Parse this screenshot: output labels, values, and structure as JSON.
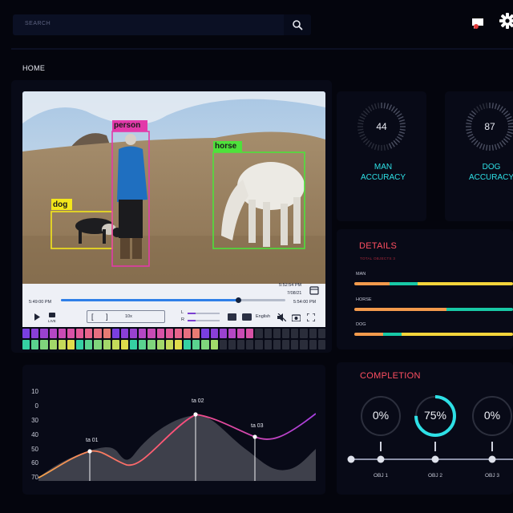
{
  "search": {
    "placeholder": "SEARCH"
  },
  "breadcrumb": "HOME",
  "detections": {
    "person": "person",
    "horse": "horse",
    "dog": "dog"
  },
  "player": {
    "start_time": "5:49:00 PM",
    "current_time": "5:52:54 PM",
    "date": "7/08/21",
    "end_time": "5:54:00 PM",
    "live_label": "LIVE",
    "bracket_open": "[",
    "bracket_close": "]",
    "speed": "10x",
    "channel_l": "L",
    "channel_r": "R",
    "cc_label": "CC",
    "language": "English",
    "progress": 0.79
  },
  "gauges": [
    {
      "value": "44",
      "label_line1": "MAN",
      "label_line2": "ACCURACY"
    },
    {
      "value": "87",
      "label_line1": "DOG",
      "label_line2": "ACCURACY"
    }
  ],
  "details": {
    "title": "DETAILS",
    "subtitle": "TOTAL OBJECTS 3",
    "items": [
      {
        "label": "MAN",
        "segments": [
          0.22,
          0.18,
          0.6
        ]
      },
      {
        "label": "HORSE",
        "segments": [
          0.58,
          0.42,
          0.0
        ]
      },
      {
        "label": "DOG",
        "segments": [
          0.18,
          0.12,
          0.7
        ]
      }
    ]
  },
  "chart": {
    "y_ticks": [
      "10",
      "0",
      "30",
      "40",
      "50",
      "60",
      "70"
    ],
    "points": [
      {
        "label": "ta 01"
      },
      {
        "label": "ta 02"
      },
      {
        "label": "ta 03"
      }
    ]
  },
  "completion": {
    "title": "COMPLETION",
    "objects": [
      {
        "value": "0%",
        "label": "OBJ 1",
        "fraction": 0.0
      },
      {
        "value": "75%",
        "label": "OBJ 2",
        "fraction": 0.75
      },
      {
        "value": "0%",
        "label": "OBJ 3",
        "fraction": 0.0
      }
    ]
  },
  "colors": {
    "accent_cyan": "#2ee0e6",
    "accent_red": "#ff4f61",
    "bar_orange": "#f39a4c",
    "bar_teal": "#18c9a6",
    "bar_yellow": "#f4d43b"
  }
}
